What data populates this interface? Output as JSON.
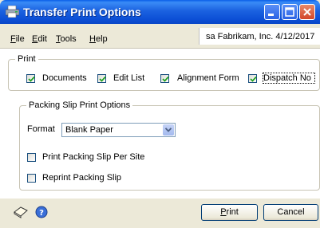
{
  "window": {
    "title": "Transfer Print Options",
    "icon": "printer-options-icon",
    "controls": [
      "minimize-icon",
      "maximize-icon",
      "close-icon"
    ]
  },
  "menu": {
    "items": [
      {
        "label": "File",
        "mnemonic": "F",
        "rest": "ile"
      },
      {
        "label": "Edit",
        "mnemonic": "E",
        "rest": "dit"
      },
      {
        "label": "Tools",
        "mnemonic": "T",
        "rest": "ools"
      },
      {
        "label": "Help",
        "mnemonic": "H",
        "rest": "elp"
      }
    ],
    "company_info": "sa  Fabrikam, Inc.  4/12/2017"
  },
  "print_group": {
    "legend": "Print",
    "options": [
      {
        "label": "Documents",
        "checked": true
      },
      {
        "label": "Edit List",
        "checked": true
      },
      {
        "label": "Alignment Form",
        "checked": true
      },
      {
        "label": "Dispatch No",
        "checked": true,
        "focused": true
      }
    ]
  },
  "packing_group": {
    "legend": "Packing Slip Print Options",
    "format_label": "Format",
    "format_value": "Blank Paper",
    "options": [
      {
        "label": "Print Packing Slip Per Site",
        "checked": false
      },
      {
        "label": "Reprint Packing Slip",
        "checked": false
      }
    ]
  },
  "footer": {
    "icons": [
      "note-icon",
      "help-icon"
    ],
    "print_button": {
      "mnemonic": "P",
      "rest": "rint",
      "label": "Print"
    },
    "cancel_button": {
      "label": "Cancel"
    }
  },
  "colors": {
    "titlebar": "#0c4fd6",
    "dialog_bg": "#ece9d8",
    "check_green": "#21a121",
    "group_border": "#c8c4b4"
  }
}
